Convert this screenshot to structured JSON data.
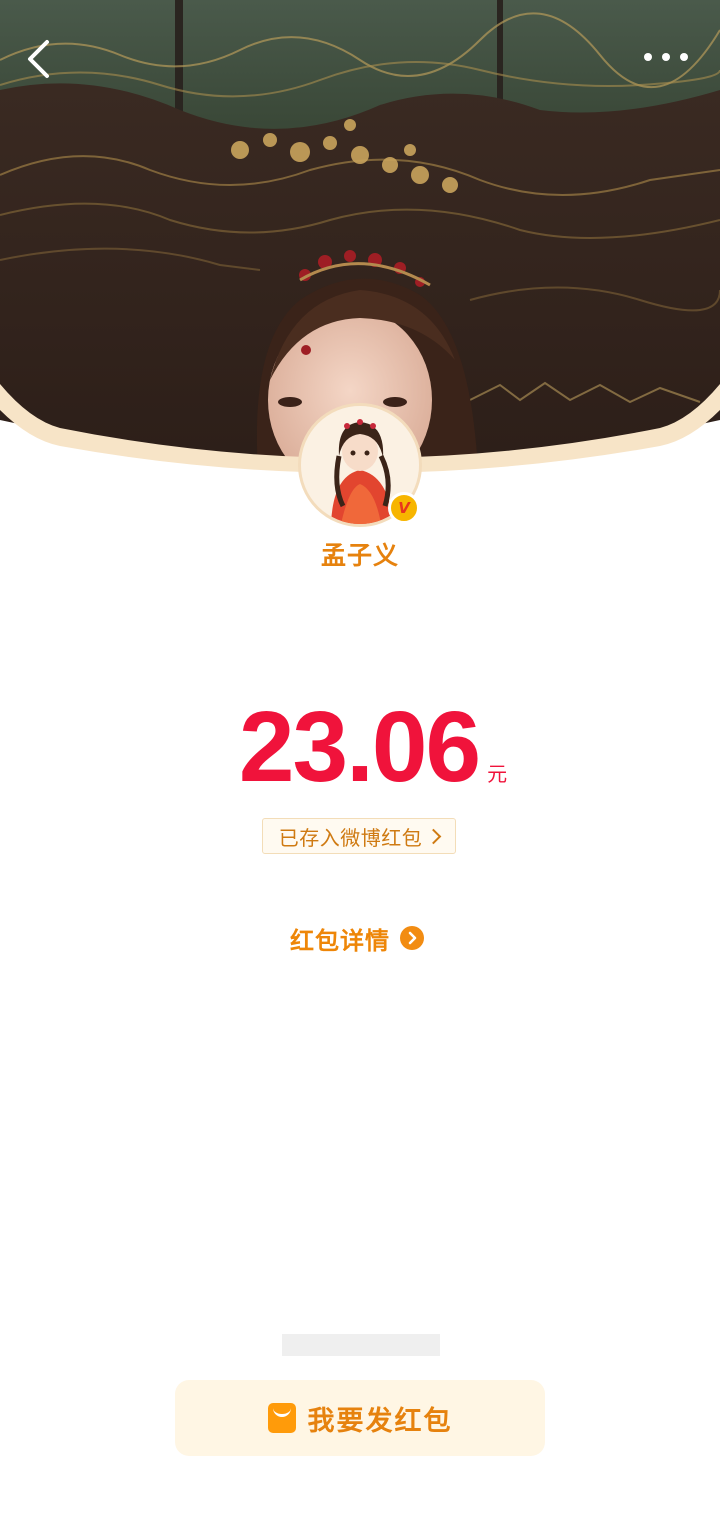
{
  "header": {
    "back_icon": "chevron-left-icon",
    "more_icon": "more-horizontal-icon"
  },
  "sender": {
    "name": "孟子义",
    "verified_badge": "V",
    "avatar_icon": "avatar-illustration"
  },
  "amount": {
    "value": "23.06",
    "unit": "元",
    "saved_label": "已存入微博红包"
  },
  "details": {
    "label": "红包详情",
    "icon": "chevron-right-circle-icon"
  },
  "footer": {
    "send_label": "我要发红包",
    "send_icon": "red-envelope-icon"
  },
  "colors": {
    "amount": "#f0133b",
    "accent": "#e6820e",
    "button_bg": "#fff6e4",
    "icon_orange": "#ff9b0a"
  }
}
